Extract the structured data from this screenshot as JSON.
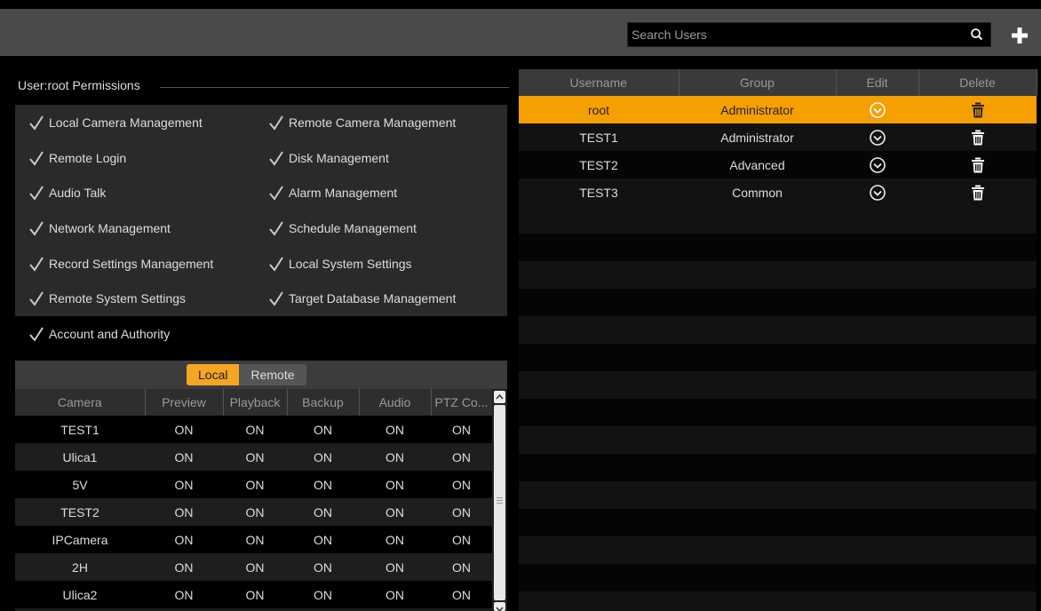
{
  "header": {
    "search_placeholder": "Search Users",
    "search_icon": "magnifier",
    "add_icon": "plus"
  },
  "permissions": {
    "title": "User:root Permissions",
    "items": [
      "Local Camera Management",
      "Remote Camera Management",
      "Remote Login",
      "Disk Management",
      "Audio Talk",
      "Alarm Management",
      "Network Management",
      "Schedule Management",
      "Record Settings Management",
      "Local System Settings",
      "Remote System Settings",
      "Target Database Management",
      "Account and Authority"
    ]
  },
  "camera_tabs": {
    "local": "Local",
    "remote": "Remote",
    "active": "Local"
  },
  "camera_table": {
    "columns": [
      "Camera",
      "Preview",
      "Playback",
      "Backup",
      "Audio",
      "PTZ Co..."
    ],
    "rows": [
      [
        "TEST1",
        "ON",
        "ON",
        "ON",
        "ON",
        "ON"
      ],
      [
        "Ulica1",
        "ON",
        "ON",
        "ON",
        "ON",
        "ON"
      ],
      [
        "5V",
        "ON",
        "ON",
        "ON",
        "ON",
        "ON"
      ],
      [
        "TEST2",
        "ON",
        "ON",
        "ON",
        "ON",
        "ON"
      ],
      [
        "IPCamera",
        "ON",
        "ON",
        "ON",
        "ON",
        "ON"
      ],
      [
        "2H",
        "ON",
        "ON",
        "ON",
        "ON",
        "ON"
      ],
      [
        "Ulica2",
        "ON",
        "ON",
        "ON",
        "ON",
        "ON"
      ]
    ]
  },
  "user_table": {
    "columns": [
      "Username",
      "Group",
      "Edit",
      "Delete"
    ],
    "rows": [
      {
        "username": "root",
        "group": "Administrator",
        "selected": true
      },
      {
        "username": "TEST1",
        "group": "Administrator",
        "selected": false
      },
      {
        "username": "TEST2",
        "group": "Advanced",
        "selected": false
      },
      {
        "username": "TEST3",
        "group": "Common",
        "selected": false
      }
    ]
  },
  "colors": {
    "accent": "#f5a000",
    "topbar": "#4a4a4a",
    "background": "#000000"
  }
}
